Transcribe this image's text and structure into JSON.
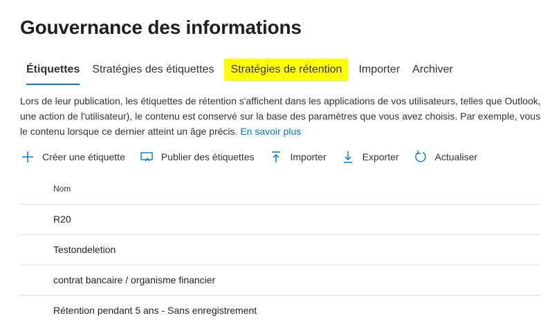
{
  "page": {
    "title": "Gouvernance des informations"
  },
  "tabs": [
    {
      "label": "Étiquettes"
    },
    {
      "label": "Stratégies des étiquettes"
    },
    {
      "label": "Stratégies de rétention"
    },
    {
      "label": "Importer"
    },
    {
      "label": "Archiver"
    }
  ],
  "description": {
    "line1": "Lors de leur publication, les étiquettes de rétention s'affichent dans les applications de vos utilisateurs, telles que Outlook, SharePoint",
    "line2": "une action de l'utilisateur), le contenu est conservé sur la base des paramètres que vous avez choisis. Par exemple, vous pouvez",
    "line3": "le contenu lorsque ce dernier atteint un âge précis.",
    "link": "En savoir plus"
  },
  "toolbar": {
    "create_label": "Créer une étiquette",
    "create_icon": "plus-icon",
    "publish_label": "Publier des étiquettes",
    "publish_icon": "publish-icon",
    "import_label": "Importer",
    "import_icon": "upload-icon",
    "export_label": "Exporter",
    "export_icon": "download-icon",
    "refresh_label": "Actualiser",
    "refresh_icon": "refresh-icon"
  },
  "table": {
    "header_name": "Nom",
    "rows": [
      {
        "name": "R20"
      },
      {
        "name": "Testondeletion"
      },
      {
        "name": "contrat bancaire / organisme financier"
      },
      {
        "name": "Rétention pendant 5 ans - Sans enregistrement"
      }
    ]
  },
  "colors": {
    "accent": "#0078d4",
    "highlight": "#ffff00",
    "text": "#323130",
    "divider": "#e1dfdd"
  }
}
